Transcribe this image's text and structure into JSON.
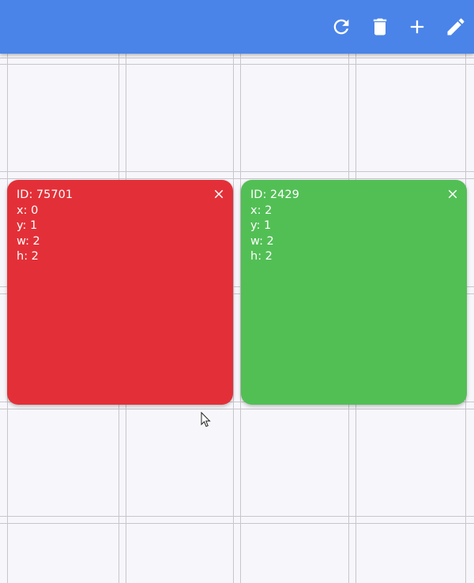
{
  "appbar": {
    "color": "#4a84e8",
    "actions": [
      {
        "icon": "refresh-icon"
      },
      {
        "icon": "delete-icon"
      },
      {
        "icon": "add-icon"
      },
      {
        "icon": "edit-icon"
      }
    ]
  },
  "cards": [
    {
      "color": "#e33038",
      "id_text": "ID: 75701",
      "x_text": "x: 0",
      "y_text": "y: 1",
      "w_text": "w: 2",
      "h_text": "h: 2",
      "close_icon": "close-icon"
    },
    {
      "color": "#52bf55",
      "id_text": "ID: 2429",
      "x_text": "x: 2",
      "y_text": "y: 1",
      "w_text": "w: 2",
      "h_text": "h: 2",
      "close_icon": "close-icon"
    }
  ]
}
